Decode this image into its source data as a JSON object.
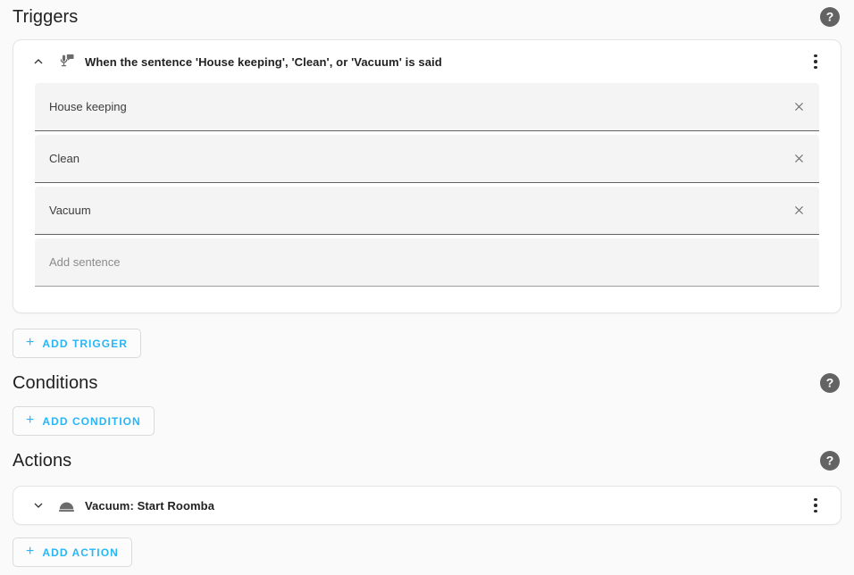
{
  "theme": {
    "page_bg": "#fafafa",
    "card_bg": "#ffffff",
    "accent": "#29b6f6",
    "text": "#212121",
    "field_bg": "#f4f4f4",
    "help_bg": "#636363"
  },
  "sections": {
    "triggers": {
      "title": "Triggers",
      "help_glyph": "?",
      "add_button": {
        "label": "ADD TRIGGER",
        "plus": "+"
      },
      "card": {
        "title": "When the sentence 'House keeping', 'Clean', or 'Vacuum' is said",
        "icon": "microphone-message-icon",
        "expanded": true,
        "chevron": "chevron-up-icon",
        "menu": "overflow-menu-icon",
        "sentences": [
          {
            "value": "House keeping",
            "clear": "close-icon"
          },
          {
            "value": "Clean",
            "clear": "close-icon"
          },
          {
            "value": "Vacuum",
            "clear": "close-icon"
          }
        ],
        "new_sentence_placeholder": "Add sentence"
      }
    },
    "conditions": {
      "title": "Conditions",
      "help_glyph": "?",
      "add_button": {
        "label": "ADD CONDITION",
        "plus": "+"
      }
    },
    "actions": {
      "title": "Actions",
      "help_glyph": "?",
      "add_button": {
        "label": "ADD ACTION",
        "plus": "+"
      },
      "card": {
        "title": "Vacuum: Start Roomba",
        "icon": "robot-vacuum-icon",
        "expanded": false,
        "chevron": "chevron-down-icon",
        "menu": "overflow-menu-icon"
      }
    }
  }
}
